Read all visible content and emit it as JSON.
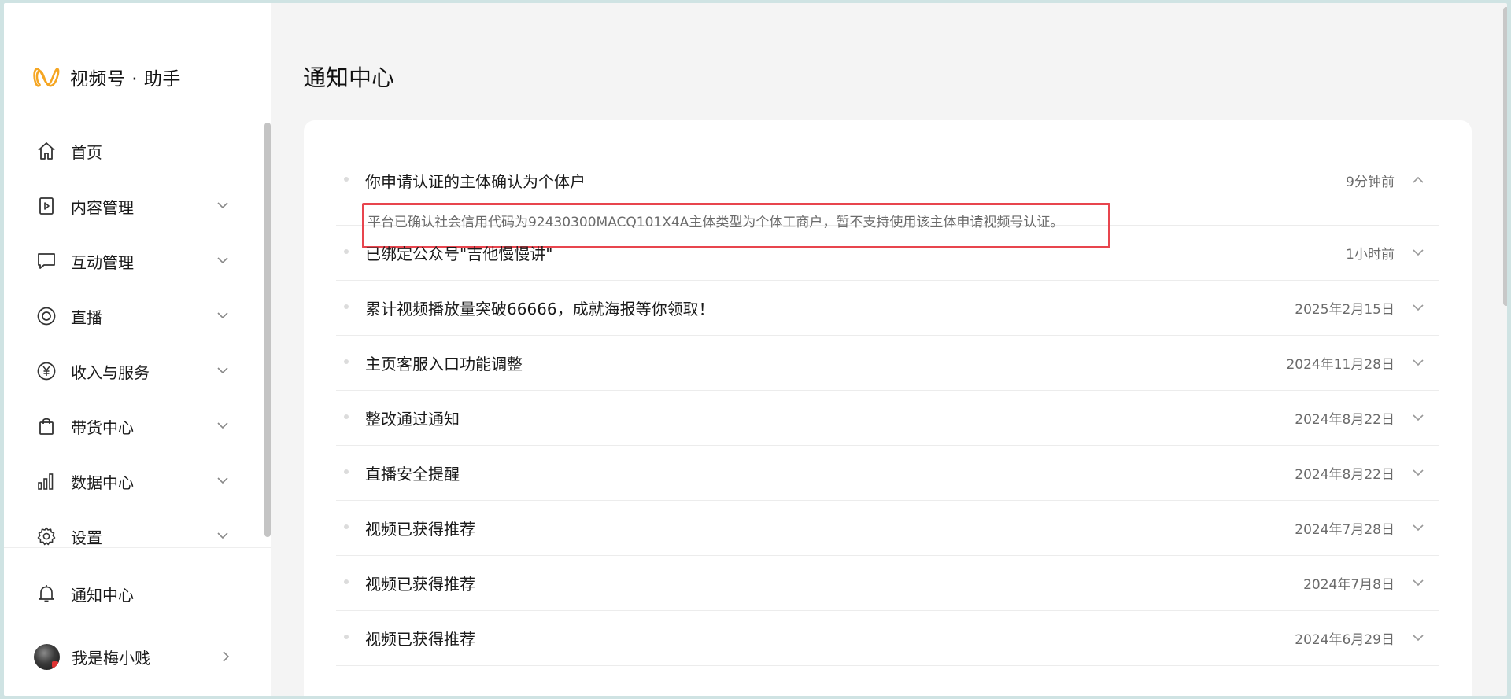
{
  "app": {
    "logo_text": "视频号 · 助手"
  },
  "sidebar": {
    "items": [
      {
        "label": "首页",
        "icon": "home-icon",
        "expandable": false
      },
      {
        "label": "内容管理",
        "icon": "video-file-icon",
        "expandable": true
      },
      {
        "label": "互动管理",
        "icon": "comment-icon",
        "expandable": true
      },
      {
        "label": "直播",
        "icon": "live-icon",
        "expandable": true
      },
      {
        "label": "收入与服务",
        "icon": "yuan-icon",
        "expandable": true
      },
      {
        "label": "带货中心",
        "icon": "shopping-bag-icon",
        "expandable": true
      },
      {
        "label": "数据中心",
        "icon": "bar-chart-icon",
        "expandable": true
      },
      {
        "label": "设置",
        "icon": "gear-icon",
        "expandable": true
      }
    ],
    "notice": {
      "label": "通知中心",
      "icon": "bell-icon"
    },
    "profile": {
      "name": "我是梅小贱"
    }
  },
  "main": {
    "title": "通知中心",
    "notifications": [
      {
        "title": "你申请认证的主体确认为个体户",
        "time": "9分钟前",
        "expanded": true,
        "detail": "平台已确认社会信用代码为92430300MACQ101X4A主体类型为个体工商户，暂不支持使用该主体申请视频号认证。"
      },
      {
        "title": "已绑定公众号\"吉他慢慢讲\"",
        "time": "1小时前",
        "expanded": false
      },
      {
        "title": "累计视频播放量突破66666，成就海报等你领取！",
        "time": "2025年2月15日",
        "expanded": false
      },
      {
        "title": "主页客服入口功能调整",
        "time": "2024年11月28日",
        "expanded": false
      },
      {
        "title": "整改通过通知",
        "time": "2024年8月22日",
        "expanded": false
      },
      {
        "title": "直播安全提醒",
        "time": "2024年8月22日",
        "expanded": false
      },
      {
        "title": "视频已获得推荐",
        "time": "2024年7月28日",
        "expanded": false
      },
      {
        "title": "视频已获得推荐",
        "time": "2024年7月8日",
        "expanded": false
      },
      {
        "title": "视频已获得推荐",
        "time": "2024年6月29日",
        "expanded": false
      }
    ]
  },
  "colors": {
    "highlight_border": "#e8454e",
    "logo_orange": "#f5a623"
  }
}
